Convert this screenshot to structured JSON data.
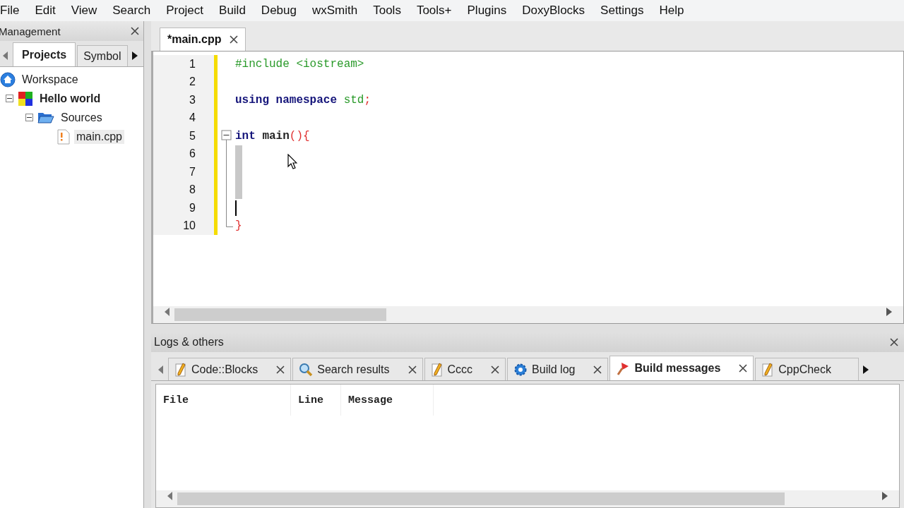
{
  "menu": [
    "File",
    "Edit",
    "View",
    "Search",
    "Project",
    "Build",
    "Debug",
    "wxSmith",
    "Tools",
    "Tools+",
    "Plugins",
    "DoxyBlocks",
    "Settings",
    "Help"
  ],
  "management": {
    "title": "Management",
    "tabs": [
      {
        "label": "Projects",
        "selected": true
      },
      {
        "label": "Symbol",
        "selected": false
      }
    ],
    "tree": [
      {
        "label": "Workspace",
        "kind": "workspace",
        "bold": false,
        "selected": false,
        "children": [
          {
            "label": "Hello world",
            "kind": "project",
            "bold": true,
            "selected": false,
            "expanded": true,
            "children": [
              {
                "label": "Sources",
                "kind": "folder",
                "bold": false,
                "selected": false,
                "expanded": true,
                "children": [
                  {
                    "label": "main.cpp",
                    "kind": "file",
                    "bold": false,
                    "selected": true
                  }
                ]
              }
            ]
          }
        ]
      }
    ]
  },
  "editor": {
    "tabs": [
      {
        "label": "*main.cpp",
        "selected": true
      }
    ],
    "lines": [
      {
        "number": "1",
        "kind": "plain",
        "changed": true,
        "tokens": [
          {
            "text": "#include <iostream>",
            "kind": "preproc",
            "gap": false
          }
        ]
      },
      {
        "number": "2",
        "kind": "plain",
        "changed": true
      },
      {
        "number": "3",
        "kind": "plain",
        "changed": true,
        "tokens": [
          {
            "text": "using namespace",
            "kind": "keyword",
            "gap": false
          },
          {
            "text": "std",
            "kind": "preproc",
            "gap": true
          },
          {
            "text": ";",
            "kind": "operator",
            "gap": false
          }
        ]
      },
      {
        "number": "4",
        "kind": "plain",
        "changed": true
      },
      {
        "number": "5",
        "kind": "fold-start",
        "changed": true,
        "tokens": [
          {
            "text": "int",
            "kind": "keyword",
            "gap": false
          },
          {
            "text": "main",
            "kind": "plain",
            "gap": true
          },
          {
            "text": "(){",
            "kind": "operator",
            "gap": false
          }
        ]
      },
      {
        "number": "6",
        "kind": "fold-body",
        "changed": true,
        "highlight": true
      },
      {
        "number": "7",
        "kind": "fold-body",
        "changed": true,
        "highlight": true
      },
      {
        "number": "8",
        "kind": "fold-body",
        "changed": true,
        "highlight": true
      },
      {
        "number": "9",
        "kind": "fold-body",
        "changed": true,
        "highlight": false,
        "caret": true
      },
      {
        "number": "10",
        "kind": "fold-end",
        "changed": true,
        "tokens": [
          {
            "text": "}",
            "kind": "operator",
            "gap": false
          }
        ]
      }
    ]
  },
  "logs": {
    "title": "Logs & others",
    "tabs": [
      {
        "label": "Code::Blocks",
        "kind": "pencil",
        "selected": false
      },
      {
        "label": "Search results",
        "kind": "magnifier",
        "selected": false
      },
      {
        "label": "Cccc",
        "kind": "pencil",
        "selected": false
      },
      {
        "label": "Build log",
        "kind": "gear",
        "selected": false
      },
      {
        "label": "Build messages",
        "kind": "pin",
        "selected": true
      },
      {
        "label": "CppCheck",
        "kind": "pencil",
        "selected": false
      }
    ],
    "columns": [
      "File",
      "Line",
      "Message"
    ]
  }
}
